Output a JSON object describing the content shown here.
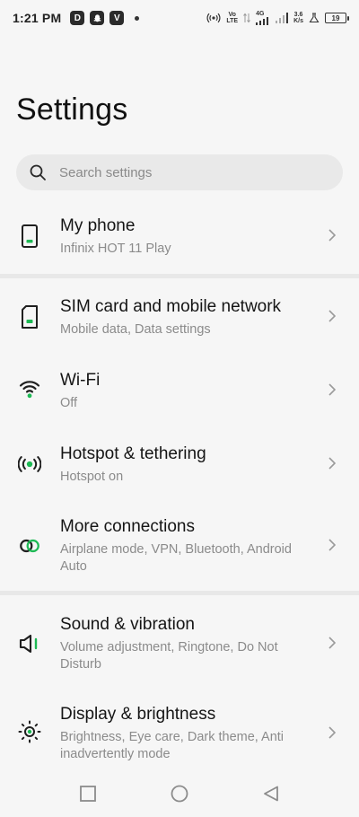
{
  "status_bar": {
    "time": "1:21 PM",
    "app_icons": [
      "D",
      "snapchat-icon",
      "V"
    ],
    "network_label_1": "Vo",
    "network_label_2": "LTE",
    "signal_label": "4G",
    "speed_value": "3.6",
    "speed_unit": "K/s",
    "battery": "19"
  },
  "header": {
    "title": "Settings"
  },
  "search": {
    "placeholder": "Search settings"
  },
  "items": [
    {
      "title": "My phone",
      "subtitle": "Infinix HOT 11 Play",
      "icon": "phone-icon"
    },
    {
      "title": "SIM card and mobile network",
      "subtitle": "Mobile data, Data settings",
      "icon": "sim-card-icon"
    },
    {
      "title": "Wi-Fi",
      "subtitle": "Off",
      "icon": "wifi-icon"
    },
    {
      "title": "Hotspot & tethering",
      "subtitle": "Hotspot on",
      "icon": "hotspot-icon"
    },
    {
      "title": "More connections",
      "subtitle": "Airplane mode, VPN, Bluetooth, Android Auto",
      "icon": "connections-icon"
    },
    {
      "title": "Sound & vibration",
      "subtitle": "Volume adjustment, Ringtone, Do Not Disturb",
      "icon": "speaker-icon"
    },
    {
      "title": "Display & brightness",
      "subtitle": "Brightness, Eye care, Dark theme, Anti inadvertently mode",
      "icon": "brightness-icon"
    }
  ],
  "colors": {
    "accent": "#1db954",
    "icon_dark": "#1f1f1f",
    "background": "#f6f6f6"
  },
  "nav": {
    "buttons": [
      "recents-icon",
      "home-icon",
      "back-icon"
    ]
  }
}
